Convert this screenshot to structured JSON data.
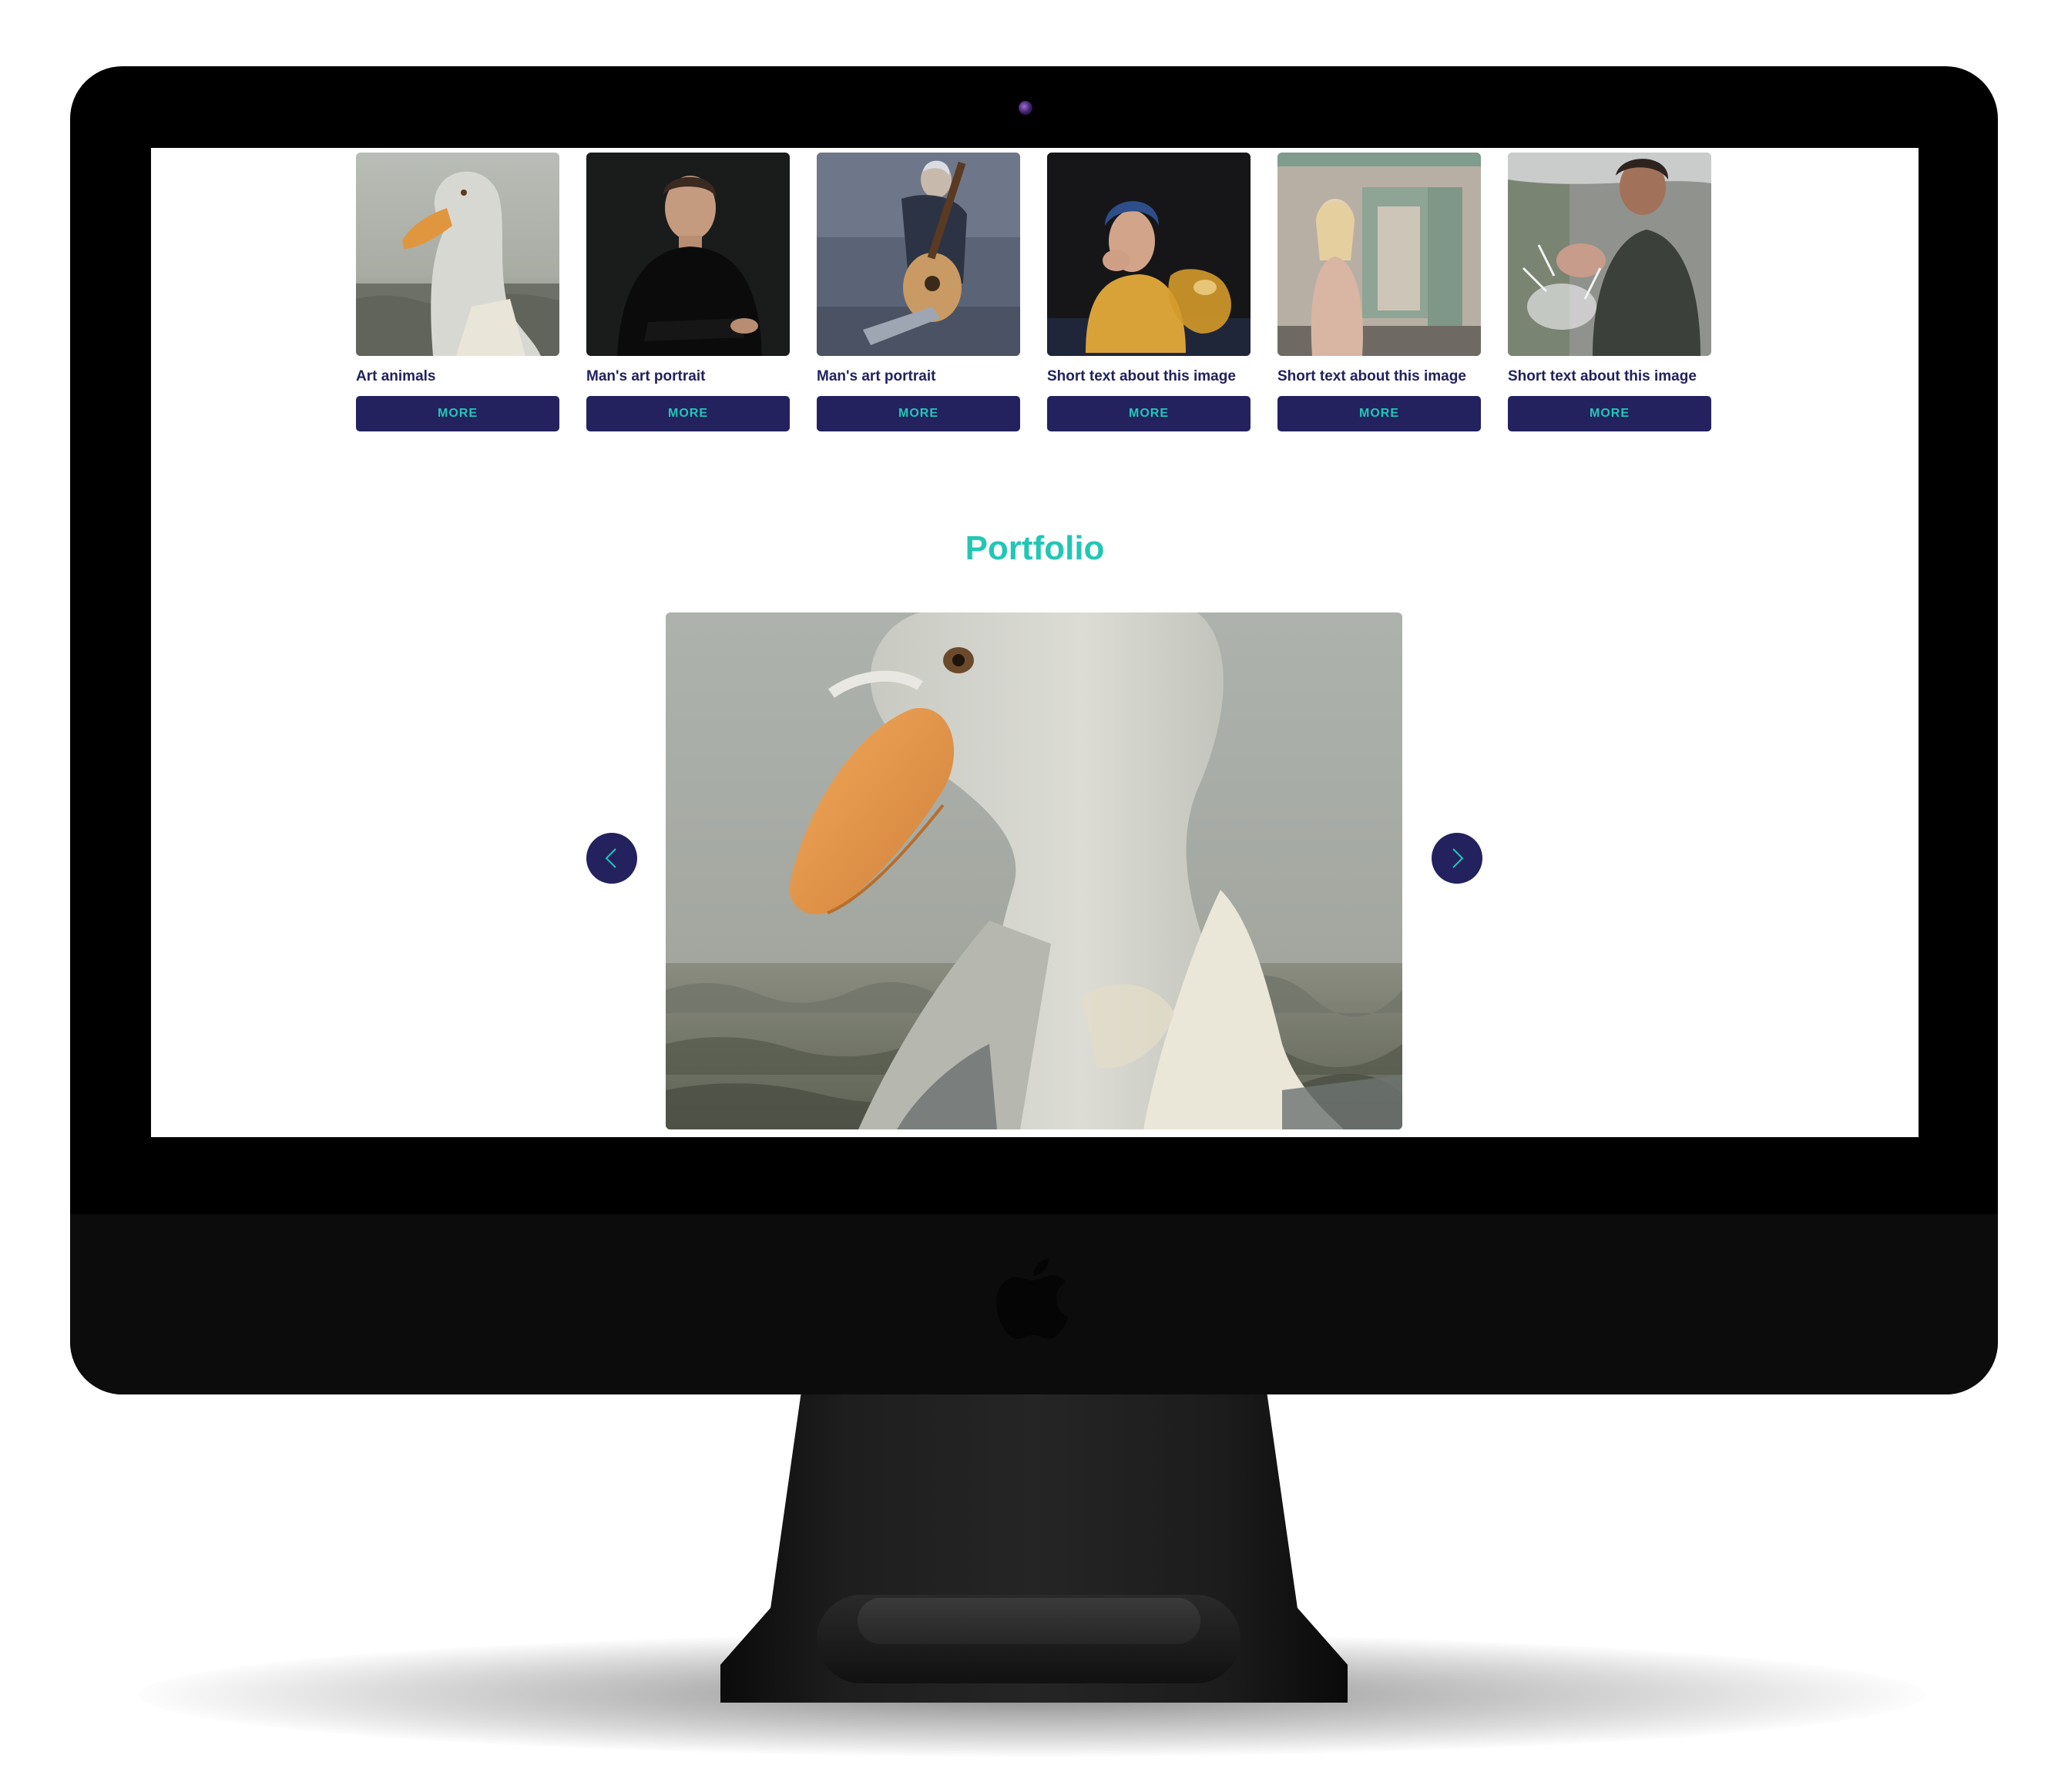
{
  "gallery": {
    "cards": [
      {
        "image": "goose-portrait",
        "caption": "Art animals",
        "button": "MORE"
      },
      {
        "image": "man-portrait",
        "caption": "Man's art portrait",
        "button": "MORE"
      },
      {
        "image": "man-with-guitar",
        "caption": "Man's art portrait",
        "button": "MORE"
      },
      {
        "image": "woman-with-vase",
        "caption": "Short text about this image",
        "button": "MORE"
      },
      {
        "image": "girl-in-room",
        "caption": "Short text about this image",
        "button": "MORE"
      },
      {
        "image": "boy-water-splash",
        "caption": "Short text about this image",
        "button": "MORE"
      }
    ]
  },
  "portfolio": {
    "title": "Portfolio",
    "current_image": "goose-portrait",
    "prev_icon": "chevron-left-icon",
    "next_icon": "chevron-right-icon"
  },
  "colors": {
    "accent": "#23c6b5",
    "button_bg": "#23225f",
    "caption_text": "#23215f"
  }
}
